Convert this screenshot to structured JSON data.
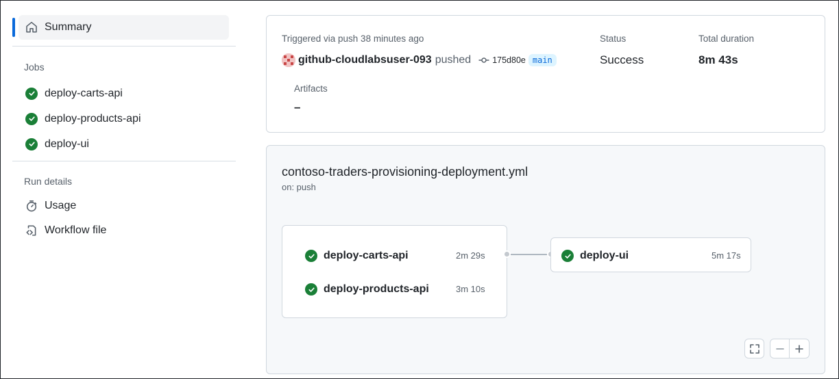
{
  "sidebar": {
    "summary_label": "Summary",
    "jobs_title": "Jobs",
    "jobs": [
      {
        "label": "deploy-carts-api"
      },
      {
        "label": "deploy-products-api"
      },
      {
        "label": "deploy-ui"
      }
    ],
    "run_details_title": "Run details",
    "run_details": [
      {
        "label": "Usage",
        "icon": "stopwatch-icon"
      },
      {
        "label": "Workflow file",
        "icon": "file-code-icon"
      }
    ]
  },
  "summary": {
    "trigger_text": "Triggered via push 38 minutes ago",
    "actor": "github-cloudlabsuser-093",
    "action": "pushed",
    "commit": "175d80e",
    "branch": "main",
    "status_label": "Status",
    "status_value": "Success",
    "duration_label": "Total duration",
    "duration_value": "8m 43s",
    "artifacts_label": "Artifacts",
    "artifacts_value": "–"
  },
  "graph": {
    "workflow_name": "contoso-traders-provisioning-deployment.yml",
    "trigger": "on: push",
    "group1": [
      {
        "name": "deploy-carts-api",
        "time": "2m 29s"
      },
      {
        "name": "deploy-products-api",
        "time": "3m 10s"
      }
    ],
    "group2": [
      {
        "name": "deploy-ui",
        "time": "5m 17s"
      }
    ]
  },
  "colors": {
    "accent": "#0969da",
    "success": "#1a7f37",
    "branch_bg": "#ddf4ff"
  }
}
